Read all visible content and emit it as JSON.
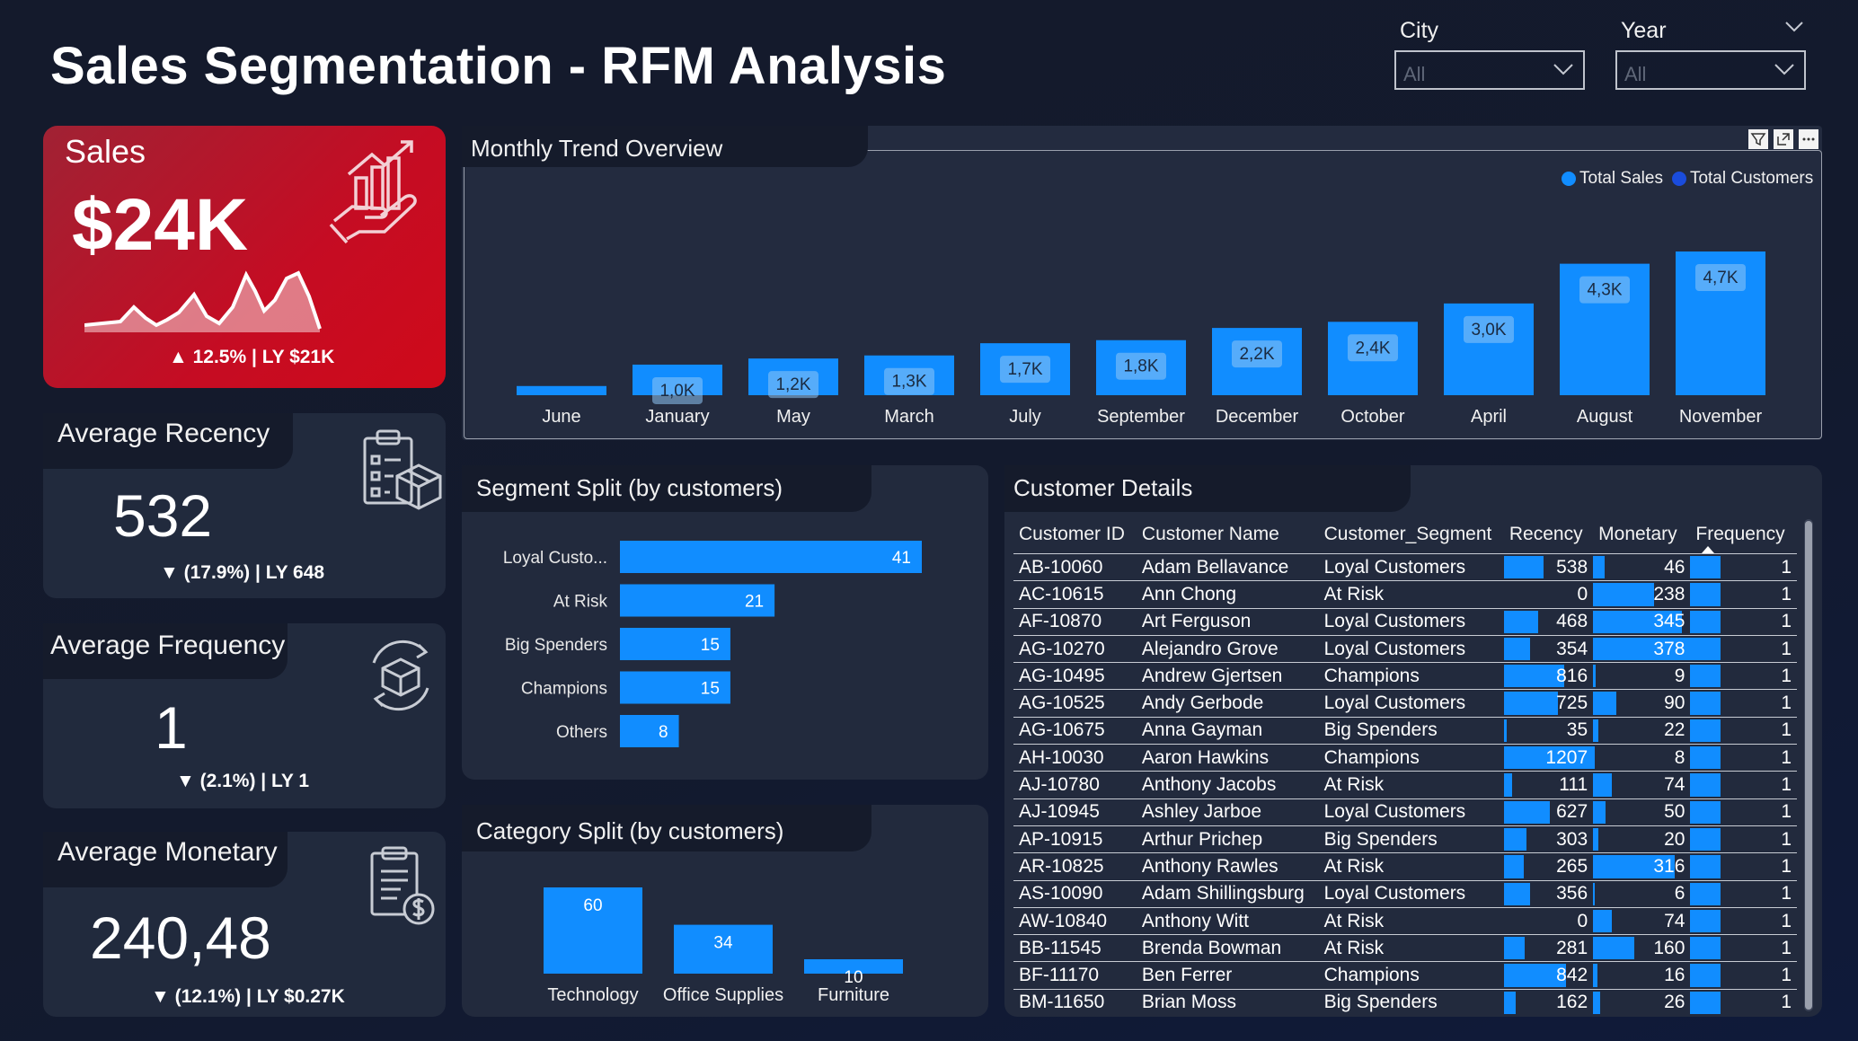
{
  "header": {
    "title": "Sales Segmentation - RFM Analysis",
    "city_label": "City",
    "city_value": "All",
    "year_label": "Year",
    "year_value": "All"
  },
  "kpis": {
    "sales": {
      "label": "Sales",
      "value": "$24K",
      "delta": "▲ 12.5% | LY $21K",
      "icon": "hand-chart-icon"
    },
    "recency": {
      "label": "Average Recency",
      "value": "532",
      "delta": "▼ (17.9%) | LY 648",
      "icon": "clipboard-box-icon"
    },
    "frequency": {
      "label": "Average Frequency",
      "value": "1",
      "delta": "▼ (2.1%) | LY 1",
      "icon": "box-cycle-icon"
    },
    "monetary": {
      "label": "Average Monetary",
      "value": "240,48",
      "delta": "▼ (12.1%) | LY $0.27K",
      "icon": "invoice-dollar-icon"
    }
  },
  "trend": {
    "title": "Monthly Trend Overview",
    "legend": [
      "Total Sales",
      "Total Customers"
    ],
    "colors": {
      "sales": "#118dff",
      "customers": "#1a4cdc"
    }
  },
  "chart_data": [
    {
      "type": "bar",
      "title": "Monthly Trend Overview",
      "categories": [
        "June",
        "January",
        "May",
        "March",
        "July",
        "September",
        "December",
        "October",
        "April",
        "August",
        "November"
      ],
      "series": [
        {
          "name": "Total Sales",
          "values": [
            0.3,
            1.0,
            1.2,
            1.3,
            1.7,
            1.8,
            2.2,
            2.4,
            3.0,
            4.3,
            4.7
          ]
        }
      ],
      "labels": [
        "",
        "1,0K",
        "1,2K",
        "1,3K",
        "1,7K",
        "1,8K",
        "2,2K",
        "2,4K",
        "3,0K",
        "4,3K",
        "4,7K"
      ],
      "legend": "top-right"
    },
    {
      "type": "bar",
      "orientation": "horizontal",
      "title": "Segment Split (by customers)",
      "categories": [
        "Loyal Custo...",
        "At Risk",
        "Big Spenders",
        "Champions",
        "Others"
      ],
      "values": [
        41,
        21,
        15,
        15,
        8
      ]
    },
    {
      "type": "bar",
      "title": "Category Split (by customers)",
      "categories": [
        "Technology",
        "Office Supplies",
        "Furniture"
      ],
      "values": [
        60,
        34,
        10
      ]
    }
  ],
  "segment": {
    "title": "Segment Split (by customers)"
  },
  "category": {
    "title": "Category Split (by customers)"
  },
  "customers": {
    "title": "Customer Details",
    "columns": [
      "Customer ID",
      "Customer Name",
      "Customer_Segment",
      "Recency",
      "Monetary",
      "Frequency"
    ],
    "rows": [
      [
        "AB-10060",
        "Adam Bellavance",
        "Loyal Customers",
        "538",
        "46",
        "1"
      ],
      [
        "AC-10615",
        "Ann Chong",
        "At Risk",
        "0",
        "238",
        "1"
      ],
      [
        "AF-10870",
        "Art Ferguson",
        "Loyal Customers",
        "468",
        "345",
        "1"
      ],
      [
        "AG-10270",
        "Alejandro Grove",
        "Loyal Customers",
        "354",
        "378",
        "1"
      ],
      [
        "AG-10495",
        "Andrew Gjertsen",
        "Champions",
        "816",
        "9",
        "1"
      ],
      [
        "AG-10525",
        "Andy Gerbode",
        "Loyal Customers",
        "725",
        "90",
        "1"
      ],
      [
        "AG-10675",
        "Anna Gayman",
        "Big Spenders",
        "35",
        "22",
        "1"
      ],
      [
        "AH-10030",
        "Aaron Hawkins",
        "Champions",
        "1207",
        "8",
        "1"
      ],
      [
        "AJ-10780",
        "Anthony Jacobs",
        "At Risk",
        "111",
        "74",
        "1"
      ],
      [
        "AJ-10945",
        "Ashley Jarboe",
        "Loyal Customers",
        "627",
        "50",
        "1"
      ],
      [
        "AP-10915",
        "Arthur Prichep",
        "Big Spenders",
        "303",
        "20",
        "1"
      ],
      [
        "AR-10825",
        "Anthony Rawles",
        "At Risk",
        "265",
        "316",
        "1"
      ],
      [
        "AS-10090",
        "Adam Shillingsburg",
        "Loyal Customers",
        "356",
        "6",
        "1"
      ],
      [
        "AW-10840",
        "Anthony Witt",
        "At Risk",
        "0",
        "74",
        "1"
      ],
      [
        "BB-11545",
        "Brenda Bowman",
        "At Risk",
        "281",
        "160",
        "1"
      ],
      [
        "BF-11170",
        "Ben Ferrer",
        "Champions",
        "842",
        "16",
        "1"
      ],
      [
        "BM-11650",
        "Brian Moss",
        "Big Spenders",
        "162",
        "26",
        "1"
      ]
    ]
  }
}
